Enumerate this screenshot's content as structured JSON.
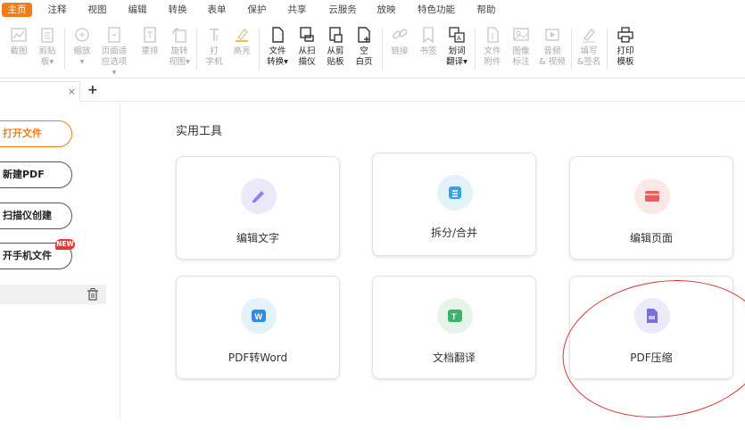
{
  "menu": {
    "items": [
      "主页",
      "注释",
      "视图",
      "编辑",
      "转换",
      "表单",
      "保护",
      "共享",
      "云服务",
      "放映",
      "特色功能",
      "帮助"
    ],
    "active_index": 0,
    "active_color": "#f07d1a"
  },
  "ribbon": {
    "items": [
      {
        "label": "截图",
        "icon": "chart-icon",
        "state": "dim"
      },
      {
        "label": "剪贴\n板▾",
        "icon": "clipboard-icon",
        "state": "dim"
      },
      {
        "label": "缩放\n▾",
        "icon": "zoom-icon",
        "state": "dim"
      },
      {
        "label": "页面适\n应选项▾",
        "icon": "fit-page-icon",
        "state": "dim"
      },
      {
        "label": "重排",
        "icon": "reflow-icon",
        "state": "dim"
      },
      {
        "label": "旋转\n视图▾",
        "icon": "rotate-icon",
        "state": "dim"
      },
      {
        "label": "打\n字机",
        "icon": "typewriter-icon",
        "state": "dim"
      },
      {
        "label": "高亮",
        "icon": "highlight-icon",
        "state": "dim"
      },
      {
        "label": "文件\n转换▾",
        "icon": "file-convert-icon",
        "state": "on"
      },
      {
        "label": "从扫\n描仪",
        "icon": "scanner-icon",
        "state": "on"
      },
      {
        "label": "从剪\n贴板",
        "icon": "from-clipboard-icon",
        "state": "on"
      },
      {
        "label": "空\n白页",
        "icon": "blank-page-icon",
        "state": "on"
      },
      {
        "label": "链接",
        "icon": "link-icon",
        "state": "dim"
      },
      {
        "label": "书签",
        "icon": "bookmark-icon",
        "state": "dim"
      },
      {
        "label": "划词\n翻译▾",
        "icon": "translate-icon",
        "state": "on"
      },
      {
        "label": "文件\n附件",
        "icon": "attachment-icon",
        "state": "dim"
      },
      {
        "label": "图像\n标注",
        "icon": "image-annotate-icon",
        "state": "dim"
      },
      {
        "label": "音频\n& 视频",
        "icon": "media-icon",
        "state": "dim"
      },
      {
        "label": "填写\n&签名",
        "icon": "sign-icon",
        "state": "dim"
      },
      {
        "label": "打印\n模板",
        "icon": "print-icon",
        "state": "on"
      }
    ]
  },
  "tabs": {
    "close": "×",
    "add": "+"
  },
  "left": {
    "buttons": [
      "打开文件",
      "新建PDF",
      "扫描仪创建",
      "开手机文件"
    ],
    "new_badge": "NEW"
  },
  "main": {
    "section_title": "实用工具",
    "tools": [
      {
        "title": "编辑文字",
        "icon": "edit-text-icon",
        "bg": "#ece9fb",
        "fg": "#8f7ff0"
      },
      {
        "title": "拆分/合并",
        "icon": "split-merge-icon",
        "bg": "#e4f3fb",
        "fg": "#3aa2e0"
      },
      {
        "title": "编辑页面",
        "icon": "edit-page-icon",
        "bg": "#fbe9e9",
        "fg": "#ef5b5b"
      },
      {
        "title": "PDF转Word",
        "icon": "pdf-to-word-icon",
        "bg": "#e4f3fb",
        "fg": "#2f8ee0"
      },
      {
        "title": "文档翻译",
        "icon": "translate-doc-icon",
        "bg": "#e6f5ea",
        "fg": "#3db369"
      },
      {
        "title": "PDF压缩",
        "icon": "pdf-compress-icon",
        "bg": "#ecebfa",
        "fg": "#7a70d8"
      }
    ]
  },
  "annotation_color": "#d9352f"
}
